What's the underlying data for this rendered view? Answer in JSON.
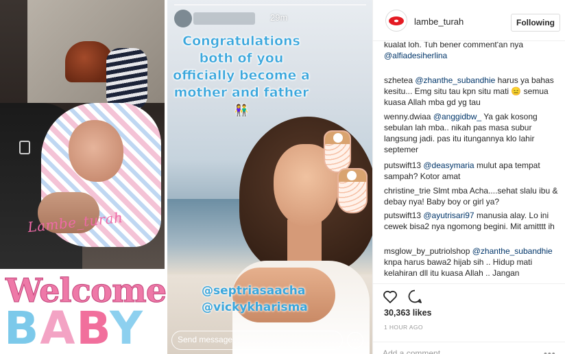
{
  "post": {
    "photo": {
      "left_watermark": "Lambe_turah",
      "welcome_text": "Welcome",
      "baby_letters": [
        "B",
        "A",
        "B",
        "Y"
      ]
    },
    "story": {
      "time": "29m",
      "congrats_text": "Congratulations both of you officially become a mother and father",
      "couple_emoji": "👫",
      "mention_1": "@septriasaacha",
      "mention_2": "@vickykharisma",
      "send_message_placeholder": "Send message",
      "more_symbol": "⋯"
    }
  },
  "header": {
    "username": "lambe_turah",
    "follow_label": "Following"
  },
  "comments": [
    {
      "user": "",
      "text": "kualat loh. Tuh bener comment'an nya",
      "mention": "@alfiadesiherlina",
      "after": ""
    },
    {
      "user": "szhetea",
      "mention": "@zhanthe_subandhie",
      "text": "harus ya bahas kesitu... Emg situ tau kpn situ mati 😑 semua kuasa Allah mba gd yg tau"
    },
    {
      "user": "wenny.dwiaa",
      "mention": "@anggidbw_",
      "text": "Ya gak kosong sebulan lah mba.. nikah pas masa subur langsung jadi. pas itu itungannya klo lahir septemer"
    },
    {
      "user": "putswift13",
      "mention": "@deasymaria",
      "text": "mulut apa tempat sampah? Kotor amat"
    },
    {
      "user": "christine_trie",
      "mention": "",
      "text": "Slmt mba Acha....sehat slalu ibu & debay nya! Baby boy or girl ya?"
    },
    {
      "user": "putswift13",
      "mention": "@ayutrisari97",
      "text": "manusia alay. Lo ini cewek bisa2 nya ngomong begini. Mit amitttt ih"
    },
    {
      "user": "msglow_by_putriolshop",
      "mention": "@zhanthe_subandhie",
      "text": "knpa harus bawa2 hijab sih .. Hidup mati kelahiran dll itu kuasa Allah .. Jangan"
    }
  ],
  "actions": {
    "likes": "30,363 likes",
    "time_ago": "1 HOUR AGO",
    "add_comment_placeholder": "Add a comment...",
    "more_symbol": "•••"
  }
}
